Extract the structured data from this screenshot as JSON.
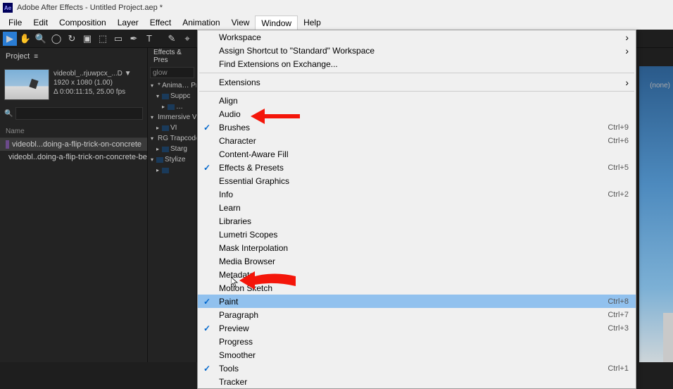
{
  "titlebar": {
    "app": "Adobe After Effects",
    "project": "Untitled Project.aep *"
  },
  "menubar": {
    "items": [
      "File",
      "Edit",
      "Composition",
      "Layer",
      "Effect",
      "Animation",
      "View",
      "Window",
      "Help"
    ],
    "activeIndex": 7
  },
  "projectPanel": {
    "tab": "Project",
    "meta": {
      "name": "videobl_..rjuwpcx_...D",
      "uses": "▼",
      "dims": "1920 x 1080 (1.00)",
      "dur": "Δ 0:00:11:15, 25.00 fps"
    },
    "search_placeholder": "",
    "list_header": "Name",
    "rows": [
      {
        "icon": "comp",
        "label": "videobl...doing-a-flip-trick-on-concrete"
      },
      {
        "icon": "vid",
        "label": "videobl..doing-a-flip-trick-on-concrete-be"
      }
    ]
  },
  "effectsPanel": {
    "tab": "Effects & Pres",
    "search_value": "glow",
    "tree": [
      {
        "lvl": 0,
        "open": true,
        "label": "* Anima… Pre"
      },
      {
        "lvl": 1,
        "open": true,
        "label": "Suppc"
      },
      {
        "lvl": 2,
        "open": false,
        "label": "…"
      },
      {
        "lvl": 0,
        "open": true,
        "label": "Immersive V"
      },
      {
        "lvl": 1,
        "open": false,
        "label": "VI"
      },
      {
        "lvl": 0,
        "open": true,
        "label": "RG Trapcode"
      },
      {
        "lvl": 1,
        "open": false,
        "label": "Starg"
      },
      {
        "lvl": 0,
        "open": true,
        "label": "Stylize"
      },
      {
        "lvl": 1,
        "open": false,
        "label": ""
      }
    ]
  },
  "windowMenu": {
    "items": [
      {
        "label": "Workspace",
        "submenu": true
      },
      {
        "label": "Assign Shortcut to \"Standard\" Workspace",
        "submenu": true
      },
      {
        "label": "Find Extensions on Exchange..."
      },
      {
        "sep": true
      },
      {
        "label": "Extensions",
        "submenu": true
      },
      {
        "sep": true
      },
      {
        "label": "Align"
      },
      {
        "label": "Audio"
      },
      {
        "label": "Brushes",
        "checked": true,
        "shortcut": "Ctrl+9"
      },
      {
        "label": "Character",
        "shortcut": "Ctrl+6"
      },
      {
        "label": "Content-Aware Fill"
      },
      {
        "label": "Effects & Presets",
        "checked": true,
        "shortcut": "Ctrl+5"
      },
      {
        "label": "Essential Graphics"
      },
      {
        "label": "Info",
        "shortcut": "Ctrl+2"
      },
      {
        "label": "Learn"
      },
      {
        "label": "Libraries"
      },
      {
        "label": "Lumetri Scopes"
      },
      {
        "label": "Mask Interpolation"
      },
      {
        "label": "Media Browser"
      },
      {
        "label": "Metadata"
      },
      {
        "label": "Motion Sketch"
      },
      {
        "label": "Paint",
        "checked": true,
        "highlight": true,
        "shortcut": "Ctrl+8"
      },
      {
        "label": "Paragraph",
        "shortcut": "Ctrl+7"
      },
      {
        "label": "Preview",
        "checked": true,
        "shortcut": "Ctrl+3"
      },
      {
        "label": "Progress"
      },
      {
        "label": "Smoother"
      },
      {
        "label": "Tools",
        "checked": true,
        "shortcut": "Ctrl+1"
      },
      {
        "label": "Tracker"
      }
    ]
  },
  "rightHeader": {
    "none_label": "(none)"
  }
}
